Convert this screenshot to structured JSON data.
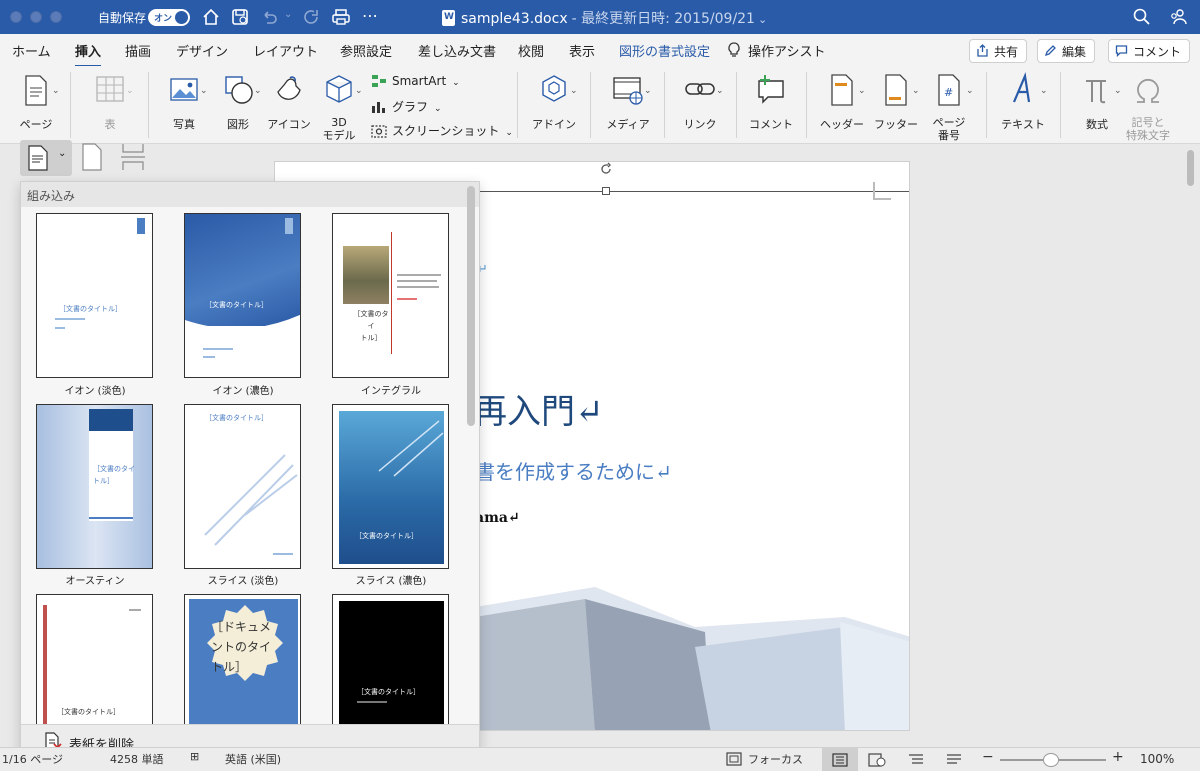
{
  "titlebar": {
    "autosave_label": "自動保存",
    "autosave_toggle": "オン",
    "doc_name": "sample43.docx",
    "doc_sub": "- 最終更新日時: 2015/09/21"
  },
  "menu": {
    "tabs": [
      "ホーム",
      "挿入",
      "描画",
      "デザイン",
      "レイアウト",
      "参照設定",
      "差し込み文書",
      "校閲",
      "表示",
      "図形の書式設定"
    ],
    "active_tab": "挿入",
    "assist_label": "操作アシスト",
    "share_label": "共有",
    "edit_label": "編集",
    "comment_label": "コメント"
  },
  "ribbon": {
    "page": "ページ",
    "table": "表",
    "photo": "写真",
    "shape": "図形",
    "icon": "アイコン",
    "model3d": "3D\nモデル",
    "smartart": "SmartArt",
    "graph": "グラフ",
    "screenshot": "スクリーンショット",
    "addin": "アドイン",
    "media": "メディア",
    "link": "リンク",
    "comment": "コメント",
    "header": "ヘッダー",
    "footer": "フッター",
    "page_number": "ページ\n番号",
    "text": "テキスト",
    "equation": "数式",
    "symbol": "記号と\n特殊文字"
  },
  "gallery": {
    "header": "組み込み",
    "items": [
      {
        "caption": "イオン (淡色)",
        "title": "［文書のタイトル］"
      },
      {
        "caption": "イオン (濃色)",
        "title": "［文書のタイトル］"
      },
      {
        "caption": "インテグラル",
        "title": "［文書のタイ\nトル］"
      },
      {
        "caption": "オースティン",
        "title": "［文書のタイ\nトル］"
      },
      {
        "caption": "スライス (淡色)",
        "title": "［文書のタイトル］"
      },
      {
        "caption": "スライス (濃色)",
        "title": "［文書のタイトル］"
      },
      {
        "caption": "",
        "title": "［文書のタイトル］"
      },
      {
        "caption": "",
        "title": "［ドキュメ\nントのタイ\nトル］"
      },
      {
        "caption": "",
        "title": "［文書のタイトル］"
      }
    ],
    "footer": "表紙を削除"
  },
  "document": {
    "heading": "再入門↵",
    "subheading": "書を作成するために↵",
    "author": "ama↵"
  },
  "statusbar": {
    "page": "1/16 ページ",
    "words": "4258 単語",
    "lang": "英語 (米国)",
    "focus": "フォーカス",
    "zoom": "100%"
  },
  "colors": {
    "accent": "#2a5ba8"
  }
}
